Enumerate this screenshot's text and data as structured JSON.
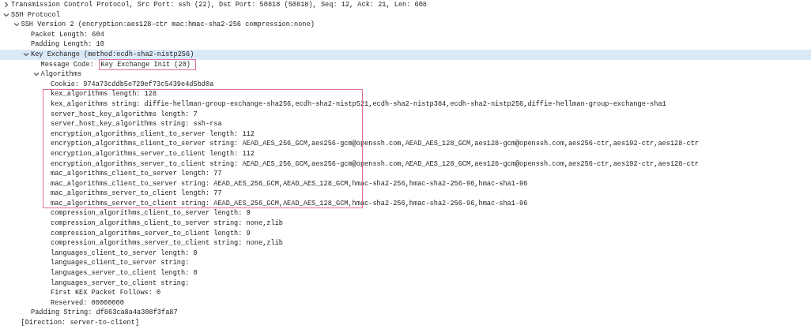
{
  "tree": [
    {
      "text": "Transmission Control Protocol, Src Port: ssh (22), Dst Port: 50818 (50818), Seq: 12, Ack: 21, Len: 608",
      "expanded": false,
      "selected": false
    },
    {
      "text": "SSH Protocol",
      "expanded": true,
      "selected": false,
      "children": [
        {
          "text": "SSH Version 2 (encryption:aes128-ctr mac:hmac-sha2-256 compression:none)",
          "expanded": true,
          "selected": false,
          "children": [
            {
              "text": "Packet Length: 604",
              "selected": false
            },
            {
              "text": "Padding Length: 10",
              "selected": false
            },
            {
              "text": "Key Exchange (method:ecdh-sha2-nistp256)",
              "expanded": true,
              "selected": true,
              "children": [
                {
                  "text": "Message Code:",
                  "value": "Key Exchange Init (20)",
                  "value_boxed": true,
                  "selected": false
                },
                {
                  "text": "Algorithms",
                  "expanded": true,
                  "selected": false,
                  "children": [
                    {
                      "text": "Cookie: 974a73cddb5e729ef73c5439e4d5bd0a",
                      "selected": false
                    },
                    {
                      "kind": "boxed_group",
                      "rows": [
                        {
                          "text": "kex_algorithms length: 128",
                          "selected": false
                        },
                        {
                          "text": "kex_algorithms string: diffie-hellman-group-exchange-sha256,ecdh-sha2-nistp521,ecdh-sha2-nistp384,ecdh-sha2-nistp256,diffie-hellman-group-exchange-sha1",
                          "selected": false
                        },
                        {
                          "text": "server_host_key_algorithms length: 7",
                          "selected": false
                        },
                        {
                          "text": "server_host_key_algorithms string: ssh-rsa",
                          "selected": false
                        },
                        {
                          "text": "encryption_algorithms_client_to_server length: 112",
                          "selected": false
                        },
                        {
                          "text": "encryption_algorithms_client_to_server string: AEAD_AES_256_GCM,aes256-gcm@openssh.com,AEAD_AES_128_GCM,aes128-gcm@openssh.com,aes256-ctr,aes192-ctr,aes128-ctr",
                          "selected": false
                        },
                        {
                          "text": "encryption_algorithms_server_to_client length: 112",
                          "selected": false
                        },
                        {
                          "text": "encryption_algorithms_server_to_client string: AEAD_AES_256_GCM,aes256-gcm@openssh.com,AEAD_AES_128_GCM,aes128-gcm@openssh.com,aes256-ctr,aes192-ctr,aes128-ctr",
                          "selected": false
                        },
                        {
                          "text": "mac_algorithms_client_to_server length: 77",
                          "selected": false
                        },
                        {
                          "text": "mac_algorithms_client_to_server string: AEAD_AES_256_GCM,AEAD_AES_128_GCM,hmac-sha2-256,hmac-sha2-256-96,hmac-sha1-96",
                          "selected": false
                        },
                        {
                          "text": "mac_algorithms_server_to_client length: 77",
                          "selected": false
                        },
                        {
                          "text": "mac_algorithms_server_to_client string: AEAD_AES_256_GCM,AEAD_AES_128_GCM,hmac-sha2-256,hmac-sha2-256-96,hmac-sha1-96",
                          "selected": false
                        }
                      ]
                    },
                    {
                      "text": "compression_algorithms_client_to_server length: 9",
                      "selected": false
                    },
                    {
                      "text": "compression_algorithms_client_to_server string: none,zlib",
                      "selected": false
                    },
                    {
                      "text": "compression_algorithms_server_to_client length: 9",
                      "selected": false
                    },
                    {
                      "text": "compression_algorithms_server_to_client string: none,zlib",
                      "selected": false
                    },
                    {
                      "text": "languages_client_to_server length: 0",
                      "selected": false
                    },
                    {
                      "text": "languages_client_to_server string:",
                      "selected": false
                    },
                    {
                      "text": "languages_server_to_client length: 0",
                      "selected": false
                    },
                    {
                      "text": "languages_server_to_client string:",
                      "selected": false
                    },
                    {
                      "text": "First KEX Packet Follows: 0",
                      "selected": false
                    },
                    {
                      "text": "Reserved: 00000000",
                      "selected": false
                    }
                  ]
                }
              ]
            },
            {
              "text": "Padding String: df863ca8a4a308f3fa87",
              "selected": false
            }
          ]
        },
        {
          "text": "[Direction: server-to-client]",
          "selected": false
        }
      ]
    }
  ]
}
